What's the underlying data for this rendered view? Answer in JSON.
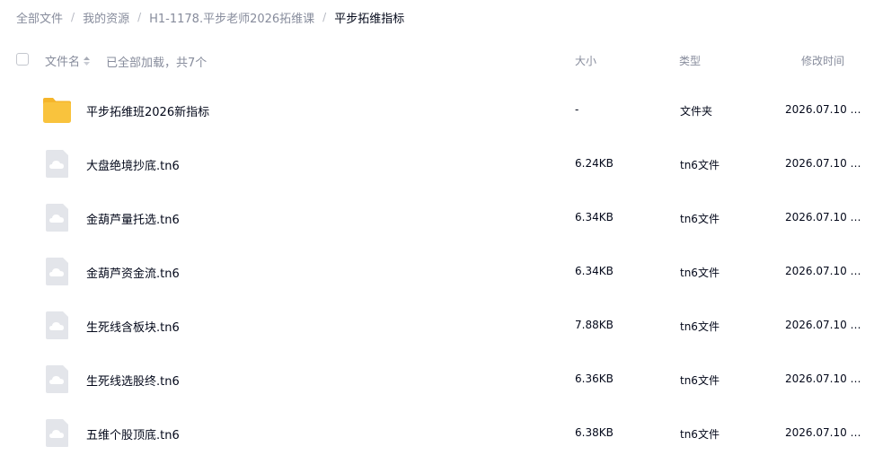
{
  "breadcrumb": [
    {
      "label": "全部文件",
      "current": false
    },
    {
      "label": "我的资源",
      "current": false
    },
    {
      "label": "H1-1178.平步老师2026拓维课",
      "current": false
    },
    {
      "label": "平步拓维指标",
      "current": true
    }
  ],
  "breadcrumb_separator": "/",
  "header": {
    "name": "文件名",
    "loaded": "已全部加载，共7个",
    "size": "大小",
    "type": "类型",
    "mtime": "修改时间"
  },
  "colors": {
    "folder": "#f9c33d",
    "file_icon_bg": "#e3e5ea",
    "text": "#03081a",
    "muted": "#878c9c"
  },
  "files": [
    {
      "name": "平步拓维班2026新指标",
      "size": "-",
      "type": "文件夹",
      "mtime": "2026.07.10 0...",
      "icon": "folder-icon"
    },
    {
      "name": "大盘绝境抄底.tn6",
      "size": "6.24KB",
      "type": "tn6文件",
      "mtime": "2026.07.10 0...",
      "icon": "file-cloud-icon"
    },
    {
      "name": "金葫芦量托选.tn6",
      "size": "6.34KB",
      "type": "tn6文件",
      "mtime": "2026.07.10 0...",
      "icon": "file-cloud-icon"
    },
    {
      "name": "金葫芦资金流.tn6",
      "size": "6.34KB",
      "type": "tn6文件",
      "mtime": "2026.07.10 0...",
      "icon": "file-cloud-icon"
    },
    {
      "name": "生死线含板块.tn6",
      "size": "7.88KB",
      "type": "tn6文件",
      "mtime": "2026.07.10 0...",
      "icon": "file-cloud-icon"
    },
    {
      "name": "生死线选股终.tn6",
      "size": "6.36KB",
      "type": "tn6文件",
      "mtime": "2026.07.10 0...",
      "icon": "file-cloud-icon"
    },
    {
      "name": "五维个股顶底.tn6",
      "size": "6.38KB",
      "type": "tn6文件",
      "mtime": "2026.07.10 0...",
      "icon": "file-cloud-icon"
    }
  ]
}
